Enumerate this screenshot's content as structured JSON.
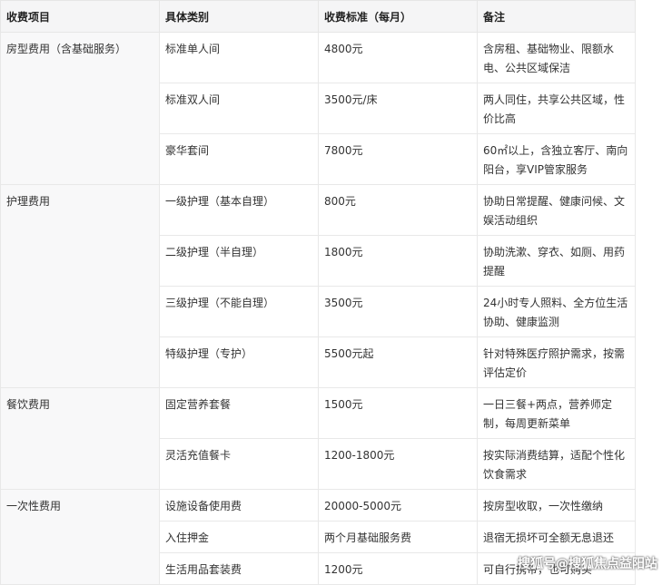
{
  "table": {
    "headers": [
      "收费项目",
      "具体类别",
      "收费标准（每月）",
      "备注"
    ],
    "groups": [
      {
        "item": "房型费用（含基础服务）",
        "rows": [
          {
            "category": "标准单人间",
            "price": "4800元",
            "note": "含房租、基础物业、限额水电、公共区域保洁"
          },
          {
            "category": "标准双人间",
            "price": "3500元/床",
            "note": "两人同住，共享公共区域，性价比高"
          },
          {
            "category": "豪华套间",
            "price": "7800元",
            "note": "60㎡以上，含独立客厅、南向阳台，享VIP管家服务"
          }
        ]
      },
      {
        "item": "护理费用",
        "rows": [
          {
            "category": "一级护理（基本自理）",
            "price": "800元",
            "note": "协助日常提醒、健康问候、文娱活动组织"
          },
          {
            "category": "二级护理（半自理）",
            "price": "1800元",
            "note": "协助洗漱、穿衣、如厕、用药提醒"
          },
          {
            "category": "三级护理（不能自理）",
            "price": "3500元",
            "note": "24小时专人照料、全方位生活协助、健康监测"
          },
          {
            "category": "特级护理（专护）",
            "price": "5500元起",
            "note": "针对特殊医疗照护需求，按需评估定价"
          }
        ]
      },
      {
        "item": "餐饮费用",
        "rows": [
          {
            "category": "固定营养套餐",
            "price": "1500元",
            "note": "一日三餐+两点，营养师定制，每周更新菜单"
          },
          {
            "category": "灵活充值餐卡",
            "price": "1200-1800元",
            "note": "按实际消费结算，适配个性化饮食需求"
          }
        ]
      },
      {
        "item": "一次性费用",
        "rows": [
          {
            "category": "设施设备使用费",
            "price": "20000-5000元",
            "note": "按房型收取，一次性缴纳"
          },
          {
            "category": "入住押金",
            "price": "两个月基础服务费",
            "note": "退宿无损坏可全额无息退还"
          },
          {
            "category": "生活用品套装费",
            "price": "1200元",
            "note": "可自行携带，也可购买"
          }
        ]
      }
    ]
  },
  "watermark": "搜狐号@搜狐焦点益阳站"
}
